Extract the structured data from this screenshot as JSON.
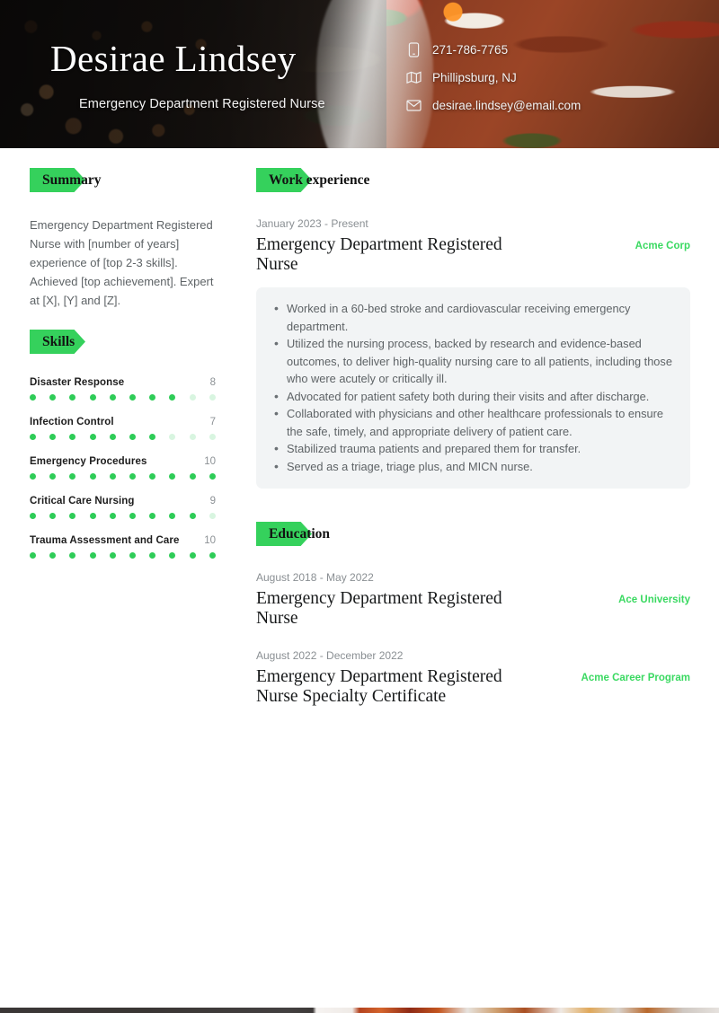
{
  "header": {
    "name": "Desirae Lindsey",
    "role": "Emergency Department Registered Nurse",
    "contacts": [
      {
        "icon": "phone-icon",
        "text": "271-786-7765"
      },
      {
        "icon": "location-map-icon",
        "text": "Phillipsburg, NJ"
      },
      {
        "icon": "envelope-icon",
        "text": "desirae.lindsey@email.com"
      }
    ]
  },
  "colors": {
    "accent_green": "#35d15c",
    "label_green": "#3ad961",
    "dot_on": "#2ecc57",
    "dot_off": "#d8f5e0",
    "card_bg": "#f2f4f5",
    "body_text": "#5e6366"
  },
  "summary": {
    "heading": "Summary",
    "text": "Emergency Department Registered Nurse with [number of years] experience of [top 2-3 skills]. Achieved [top achievement]. Expert at [X], [Y] and [Z]."
  },
  "skills": {
    "heading": "Skills",
    "max": 10,
    "items": [
      {
        "name": "Disaster Response",
        "score": 8
      },
      {
        "name": "Infection Control",
        "score": 7
      },
      {
        "name": "Emergency Procedures",
        "score": 10
      },
      {
        "name": "Critical Care Nursing",
        "score": 9
      },
      {
        "name": "Trauma Assessment and Care",
        "score": 10
      }
    ]
  },
  "work_experience": {
    "heading": "Work experience",
    "entries": [
      {
        "date": "January 2023 - Present",
        "title": "Emergency Department Registered Nurse",
        "org": "Acme Corp",
        "bullets": [
          "Worked in a 60-bed stroke and cardiovascular receiving emergency department.",
          "Utilized the nursing process, backed by research and evidence-based outcomes, to deliver high-quality nursing care to all patients, including those who were acutely or critically ill.",
          "Advocated for patient safety both during their visits and after discharge.",
          "Collaborated with physicians and other healthcare professionals to ensure the safe, timely, and appropriate delivery of patient care.",
          "Stabilized trauma patients and prepared them for transfer.",
          "Served as a triage, triage plus, and MICN nurse."
        ]
      }
    ]
  },
  "education": {
    "heading": "Education",
    "entries": [
      {
        "date": "August 2018 - May 2022",
        "title": "Emergency Department Registered Nurse",
        "org": "Ace University"
      },
      {
        "date": "August 2022 - December 2022",
        "title": "Emergency Department Registered Nurse Specialty Certificate",
        "org": "Acme Career Program"
      }
    ]
  }
}
